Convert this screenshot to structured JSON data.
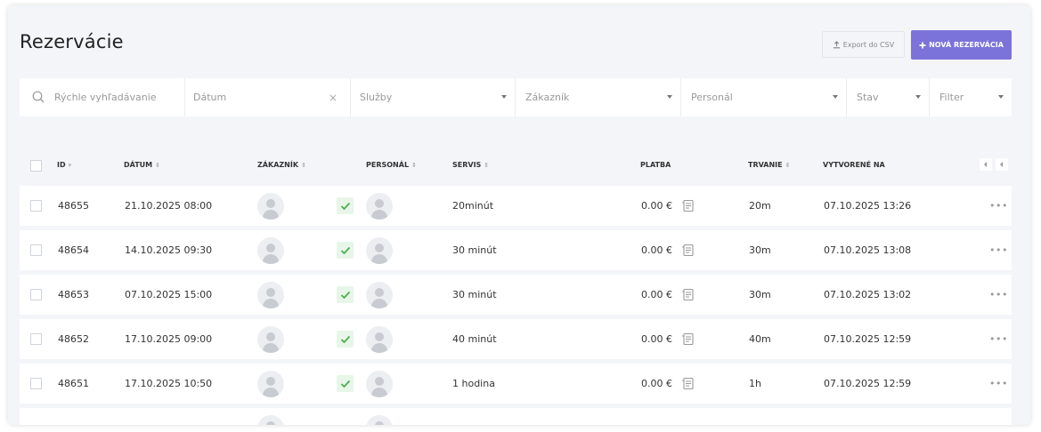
{
  "page": {
    "title": "Rezervácie"
  },
  "actions": {
    "export_label": "Export do CSV",
    "new_label": "NOVÁ REZERVÁCIA"
  },
  "filters": {
    "search_placeholder": "Rýchle vyhľadávanie",
    "date_placeholder": "Dátum",
    "date_clear": "×",
    "services": "Služby",
    "customer": "Zákazník",
    "staff": "Personál",
    "status": "Stav",
    "filter": "Filter"
  },
  "table": {
    "columns": {
      "id": "ID",
      "date": "DÁTUM",
      "customer": "ZÁKAZNÍK",
      "staff": "PERSONÁL",
      "service": "SERVIS",
      "payment": "PLATBA",
      "duration": "TRVANIE",
      "created": "VYTVORENÉ NA"
    },
    "sort_marks": {
      "asc": "▾",
      "both": "⇕"
    },
    "rows": [
      {
        "id": "48655",
        "date": "21.10.2025 08:00",
        "service": "20minút",
        "payment": "0.00 €",
        "duration": "20m",
        "created": "07.10.2025 13:26"
      },
      {
        "id": "48654",
        "date": "14.10.2025 09:30",
        "service": "30 minút",
        "payment": "0.00 €",
        "duration": "30m",
        "created": "07.10.2025 13:08"
      },
      {
        "id": "48653",
        "date": "07.10.2025 15:00",
        "service": "30 minút",
        "payment": "0.00 €",
        "duration": "30m",
        "created": "07.10.2025 13:02"
      },
      {
        "id": "48652",
        "date": "17.10.2025 09:00",
        "service": "40 minút",
        "payment": "0.00 €",
        "duration": "40m",
        "created": "07.10.2025 12:59"
      },
      {
        "id": "48651",
        "date": "17.10.2025 10:50",
        "service": "1 hodina",
        "payment": "0.00 €",
        "duration": "1h",
        "created": "07.10.2025 12:59"
      }
    ],
    "row_menu": "•••"
  },
  "colors": {
    "accent": "#7b73d9",
    "confirmed_bg": "#e7f6e8",
    "confirmed": "#4caf50",
    "background": "#f4f5f8"
  },
  "icons": [
    "search-icon",
    "upload-icon",
    "plus-icon",
    "chevron-down-icon",
    "check-icon",
    "receipt-icon",
    "more-icon",
    "scroll-left-icon"
  ]
}
